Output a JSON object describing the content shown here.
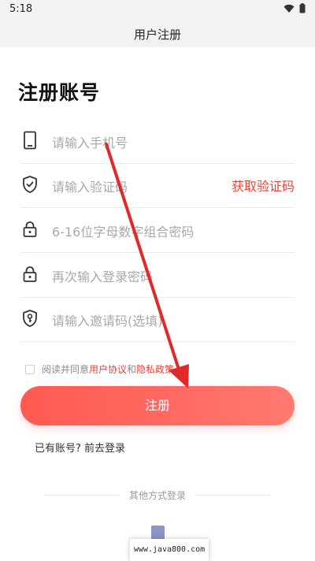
{
  "status_bar": {
    "time": "5:18"
  },
  "app_bar": {
    "title": "用户注册"
  },
  "heading": "注册账号",
  "fields": {
    "phone": {
      "placeholder": "请输入手机号"
    },
    "code": {
      "placeholder": "请输入验证码",
      "action": "获取验证码"
    },
    "password": {
      "placeholder": "6-16位字母数字组合密码"
    },
    "confirm": {
      "placeholder": "再次输入登录密码"
    },
    "invite": {
      "placeholder": "请输入邀请码(选填)"
    }
  },
  "agreement": {
    "prefix": "阅读并同意",
    "user_agreement": "用户协议",
    "and": "和",
    "privacy_policy": "隐私政策"
  },
  "register_button": "注册",
  "login_link": "已有账号? 前去登录",
  "other_login": "其他方式登录",
  "watermark": "www.java800.com",
  "colors": {
    "accent": "#e8433b",
    "button": "#ff5a52",
    "annotation_arrow": "#e02a2a"
  }
}
